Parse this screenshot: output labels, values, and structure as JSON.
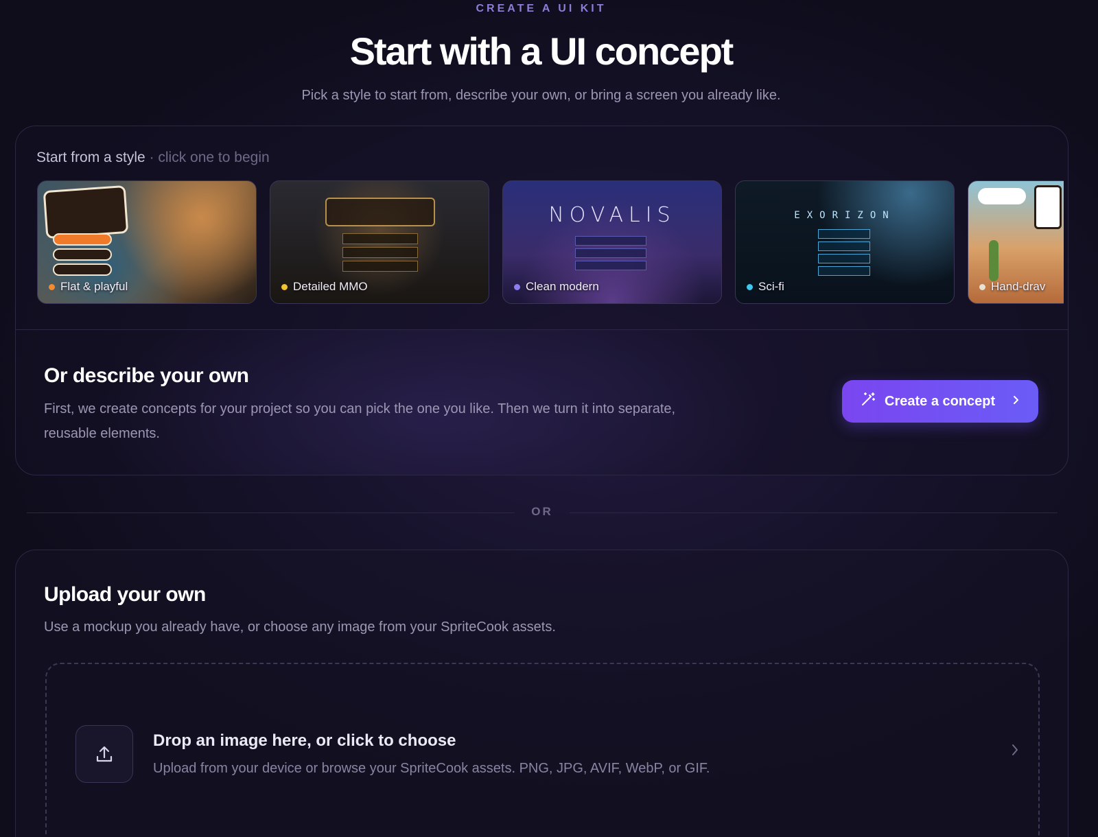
{
  "header": {
    "eyebrow": "CREATE A UI KIT",
    "title": "Start with a UI concept",
    "subtitle": "Pick a style to start from, describe your own, or bring a screen you already like."
  },
  "styles": {
    "heading": "Start from a style",
    "hint": "· click one to begin",
    "cards": [
      {
        "label": "Flat & playful",
        "dot_color": "#f28a2e"
      },
      {
        "label": "Detailed MMO",
        "dot_color": "#f2c232"
      },
      {
        "label": "Clean modern",
        "dot_color": "#8b7ff0"
      },
      {
        "label": "Sci-fi",
        "dot_color": "#3ec8f0"
      },
      {
        "label": "Hand-drav",
        "dot_color": "#e8e2d6"
      }
    ]
  },
  "describe": {
    "title": "Or describe your own",
    "body": "First, we create concepts for your project so you can pick the one you like. Then we turn it into separate, reusable elements.",
    "cta_label": "Create a concept"
  },
  "divider": {
    "label": "OR"
  },
  "upload": {
    "title": "Upload your own",
    "description": "Use a mockup you already have, or choose any image from your SpriteCook assets.",
    "drop_title": "Drop an image here, or click to choose",
    "drop_description": "Upload from your device or browse your SpriteCook assets. PNG, JPG, AVIF, WebP, or GIF."
  },
  "icons": {
    "cta": "magic-wand-icon",
    "cta_chevron": "chevron-right-icon",
    "upload": "upload-icon",
    "drop_chevron": "chevron-right-icon"
  },
  "colors": {
    "accent": "#7a46f0",
    "eyebrow": "#8b7ed6",
    "background": "#16122a"
  }
}
